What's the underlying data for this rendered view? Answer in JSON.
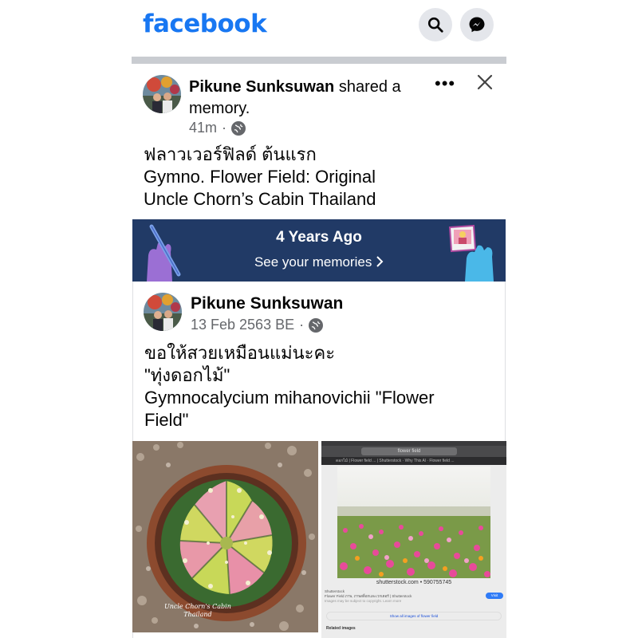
{
  "header": {
    "logo": "facebook",
    "search_icon": "search-icon",
    "messenger_icon": "messenger-icon"
  },
  "post": {
    "author": "Pikune Sunksuwan",
    "action": " shared a memory.",
    "time": "41m",
    "privacy_icon": "globe-icon",
    "more_icon": "more-options-icon",
    "more_label": "•••",
    "close_icon": "close-icon",
    "text_lines": [
      "ฟลาวเวอร์ฟิลด์ ต้นแรก",
      "Gymno. Flower Field: Original",
      "Uncle Chorn’s Cabin Thailand"
    ]
  },
  "memory": {
    "title": "4 Years Ago",
    "link": "See your memories"
  },
  "shared_post": {
    "author": "Pikune Sunksuwan",
    "date": "13 Feb 2563 BE",
    "text_lines": [
      "ขอให้สวยเหมือนแม่นะคะ",
      "\"ทุ่งดอกไม้\"",
      "Gymnocalycium mihanovichii \"Flower",
      "Field\""
    ],
    "photo_left": {
      "watermark_line1": "Uncle Chorn's Cabin",
      "watermark_line2": "Thailand"
    },
    "photo_right": {
      "url_text": "flower field",
      "tab_text": "ดอกไม้ | Flower field ... | Shutterstock  ·  Why This Al  ·  Flower field ...",
      "credit": "shutterstock.com • 590755745",
      "source": "Shutterstock",
      "caption": "Flower Field ภาพ, ภาพสต็อกและเวกเตอร์ | Shutterstock",
      "notice": "Images may be subject to copyright. Learn more",
      "visit": "Visit",
      "show_all": "Show all images of flower field",
      "related": "Related images"
    }
  }
}
